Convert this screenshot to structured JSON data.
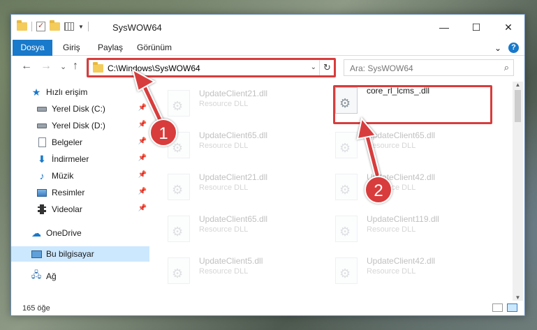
{
  "window": {
    "title": "SysWOW64",
    "controls": {
      "minimize": "—",
      "maximize": "☐",
      "close": "✕"
    }
  },
  "ribbon": {
    "tabs": [
      "Dosya",
      "Giriş",
      "Paylaş",
      "Görünüm"
    ],
    "expand_chevron": "⌄",
    "help": "?"
  },
  "nav": {
    "back": "←",
    "forward": "→",
    "recent": "⌄",
    "up": "↑",
    "address": "C:\\Windows\\SysWOW64",
    "address_chevron": "⌄",
    "refresh": "↻",
    "search_placeholder": "Ara: SysWOW64",
    "search_icon": "⌕"
  },
  "sidebar": {
    "items": [
      {
        "label": "Hızlı erişim",
        "icon": "star-icon"
      },
      {
        "label": "Yerel Disk (C:)",
        "icon": "disk-icon",
        "pinned": true
      },
      {
        "label": "Yerel Disk (D:)",
        "icon": "disk-icon",
        "pinned": true
      },
      {
        "label": "Belgeler",
        "icon": "document-icon",
        "pinned": true
      },
      {
        "label": "İndirmeler",
        "icon": "download-icon",
        "pinned": true
      },
      {
        "label": "Müzik",
        "icon": "music-icon",
        "pinned": true
      },
      {
        "label": "Resimler",
        "icon": "pictures-icon",
        "pinned": true
      },
      {
        "label": "Videolar",
        "icon": "videos-icon",
        "pinned": true
      },
      {
        "label": "OneDrive",
        "icon": "cloud-icon"
      },
      {
        "label": "Bu bilgisayar",
        "icon": "computer-icon",
        "selected": true
      },
      {
        "label": "Ağ",
        "icon": "network-icon"
      }
    ],
    "pin_glyph": "📌"
  },
  "files": {
    "left": [
      {
        "name": "UpdateClient21.dll",
        "type": "Resource DLL"
      },
      {
        "name": "UpdateClient65.dll",
        "type": "Resource DLL"
      },
      {
        "name": "UpdateClient21.dll",
        "type": "Resource DLL"
      },
      {
        "name": "UpdateClient65.dll",
        "type": "Resource DLL"
      },
      {
        "name": "UpdateClient5.dll",
        "type": "Resource DLL"
      }
    ],
    "right": [
      {
        "name": "core_rl_lcms_.dll",
        "type": "",
        "highlight": true
      },
      {
        "name": "UpdateClient65.dll",
        "type": "Resource DLL"
      },
      {
        "name": "UpdateClient42.dll",
        "type": "Resource DLL"
      },
      {
        "name": "UpdateClient119.dll",
        "type": "Resource DLL"
      },
      {
        "name": "UpdateClient42.dll",
        "type": "Resource DLL"
      }
    ]
  },
  "status": {
    "count": "165 öğe"
  },
  "annotations": {
    "step1": "1",
    "step2": "2",
    "color": "#d83c3c"
  }
}
